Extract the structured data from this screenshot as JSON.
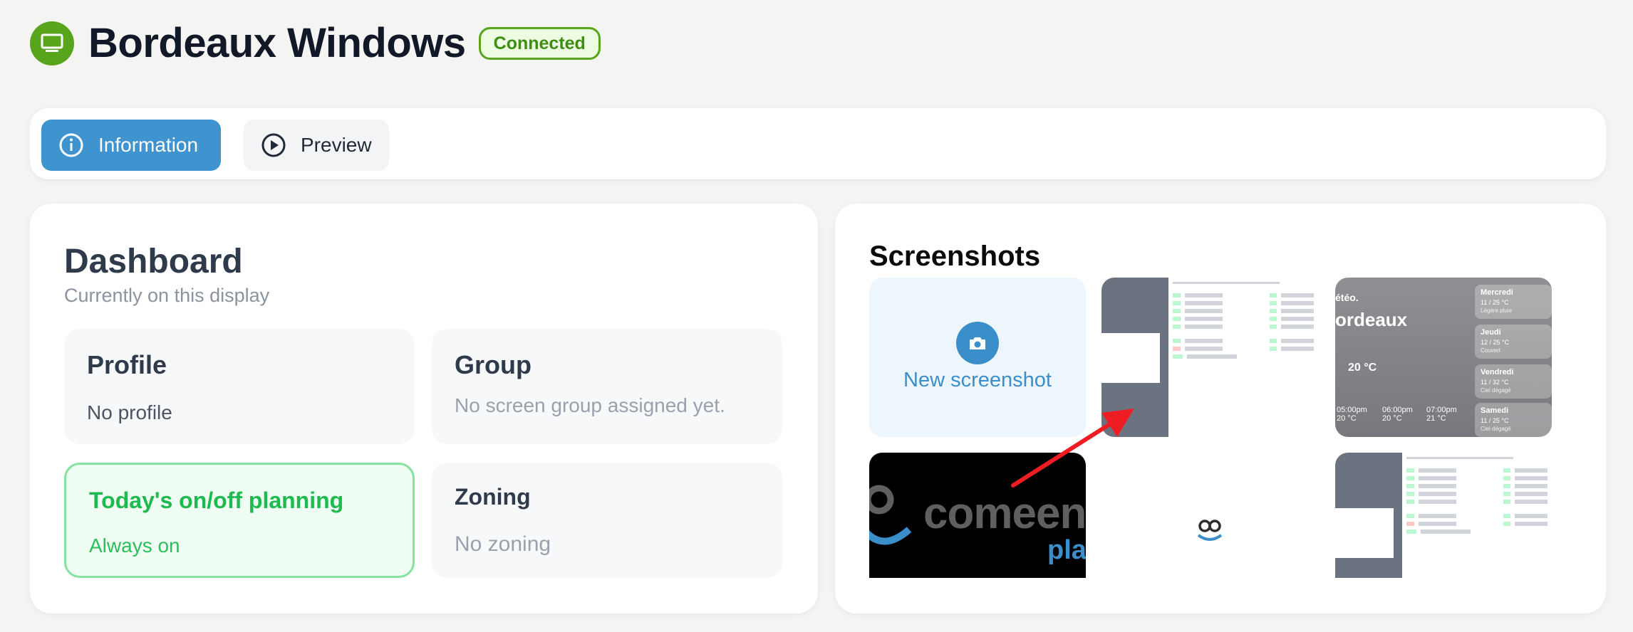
{
  "header": {
    "title": "Bordeaux Windows",
    "status": "Connected",
    "icon": "monitor-icon",
    "accent": "#58a51b"
  },
  "tabs": [
    {
      "label": "Information",
      "icon": "info-icon",
      "active": true
    },
    {
      "label": "Preview",
      "icon": "play-circle-icon",
      "active": false
    }
  ],
  "dashboard": {
    "title": "Dashboard",
    "subtitle": "Currently on this display",
    "profile": {
      "title": "Profile",
      "value": "No profile"
    },
    "group": {
      "title": "Group",
      "value": "No screen group assigned yet."
    },
    "planning": {
      "title": "Today's on/off planning",
      "value": "Always on"
    },
    "zoning": {
      "title": "Zoning",
      "value": "No zoning"
    }
  },
  "screenshots": {
    "title": "Screenshots",
    "new_label": "New screenshot",
    "weather": {
      "header": "étéo.",
      "city": "ordeaux",
      "temp": "20 °C",
      "days": [
        {
          "day": "Mercredi",
          "temp": "11 / 25 °C",
          "cond": "Légère pluie"
        },
        {
          "day": "Jeudi",
          "temp": "12 / 25 °C",
          "cond": "Couvert"
        },
        {
          "day": "Vendredi",
          "temp": "11 / 32 °C",
          "cond": "Ciel dégagé"
        },
        {
          "day": "Samedi",
          "temp": "11 / 25 °C",
          "cond": "Ciel dégagé"
        }
      ],
      "hours": [
        {
          "time": "05:00pm",
          "temp": "20 °C"
        },
        {
          "time": "06:00pm",
          "temp": "20 °C"
        },
        {
          "time": "07:00pm",
          "temp": "21 °C"
        }
      ]
    },
    "brand": {
      "word": "comeen",
      "sub": "play"
    }
  }
}
